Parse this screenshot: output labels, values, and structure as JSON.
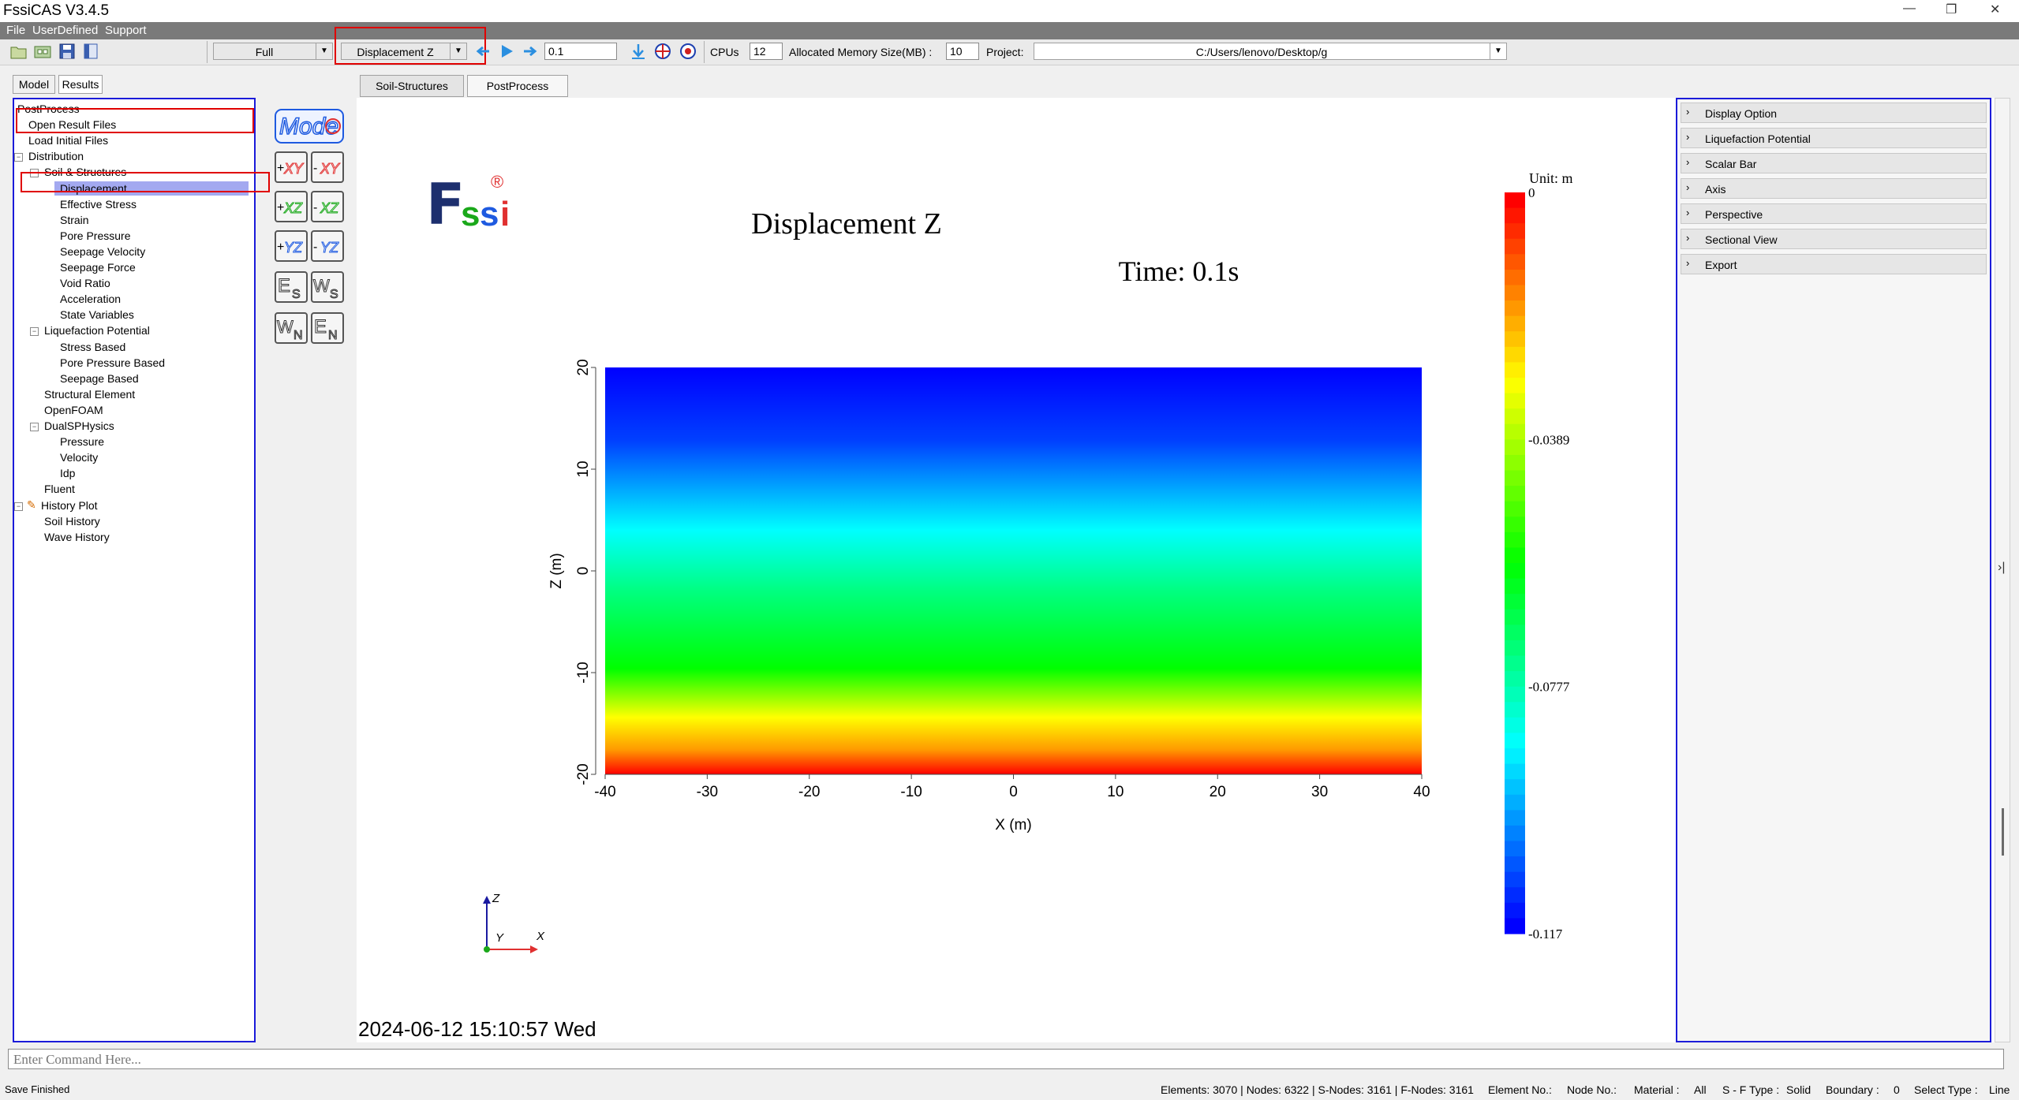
{
  "app": {
    "title": "FssiCAS V3.4.5"
  },
  "menu": [
    "File",
    "UserDefined",
    "Support"
  ],
  "toolbar": {
    "mode_select": "Full",
    "result_select": "Displacement Z",
    "step_value": "0.1",
    "cpus_label": "CPUs",
    "cpus_value": "12",
    "memory_label": "Allocated Memory Size(MB) :",
    "memory_value": "10",
    "project_label": "Project:",
    "project_value": "C:/Users/lenovo/Desktop/g"
  },
  "left_tabs": [
    "Model",
    "Results"
  ],
  "tree": [
    {
      "label": "PostProcess",
      "level": 0,
      "toggle": "",
      "icon": false
    },
    {
      "label": "Open Result Files",
      "level": 1,
      "toggle": "",
      "icon": false
    },
    {
      "label": "Load Initial Files",
      "level": 1,
      "toggle": "",
      "icon": false
    },
    {
      "label": "Distribution",
      "level": 1,
      "toggle": "-",
      "icon": false
    },
    {
      "label": "Soil & Structures",
      "level": 2,
      "toggle": "-",
      "icon": false
    },
    {
      "label": "Displacement",
      "level": 3,
      "toggle": "",
      "icon": false,
      "selected": true
    },
    {
      "label": "Effective Stress",
      "level": 3,
      "toggle": "",
      "icon": false
    },
    {
      "label": "Strain",
      "level": 3,
      "toggle": "",
      "icon": false
    },
    {
      "label": "Pore Pressure",
      "level": 3,
      "toggle": "",
      "icon": false
    },
    {
      "label": "Seepage Velocity",
      "level": 3,
      "toggle": "",
      "icon": false
    },
    {
      "label": "Seepage Force",
      "level": 3,
      "toggle": "",
      "icon": false
    },
    {
      "label": "Void Ratio",
      "level": 3,
      "toggle": "",
      "icon": false
    },
    {
      "label": "Acceleration",
      "level": 3,
      "toggle": "",
      "icon": false
    },
    {
      "label": "State Variables",
      "level": 3,
      "toggle": "",
      "icon": false
    },
    {
      "label": "Liquefaction Potential",
      "level": 2,
      "toggle": "-",
      "icon": false
    },
    {
      "label": "Stress Based",
      "level": 3,
      "toggle": "",
      "icon": false
    },
    {
      "label": "Pore Pressure Based",
      "level": 3,
      "toggle": "",
      "icon": false
    },
    {
      "label": "Seepage Based",
      "level": 3,
      "toggle": "",
      "icon": false
    },
    {
      "label": "Structural Element",
      "level": 2,
      "toggle": "",
      "icon": false
    },
    {
      "label": "OpenFOAM",
      "level": 2,
      "toggle": "",
      "icon": false
    },
    {
      "label": "DualSPHysics",
      "level": 2,
      "toggle": "-",
      "icon": false
    },
    {
      "label": "Pressure",
      "level": 3,
      "toggle": "",
      "icon": false
    },
    {
      "label": "Velocity",
      "level": 3,
      "toggle": "",
      "icon": false
    },
    {
      "label": "Idp",
      "level": 3,
      "toggle": "",
      "icon": false
    },
    {
      "label": "Fluent",
      "level": 2,
      "toggle": "",
      "icon": false
    },
    {
      "label": "History Plot",
      "level": 1,
      "toggle": "-",
      "icon": true
    },
    {
      "label": "Soil History",
      "level": 2,
      "toggle": "",
      "icon": false
    },
    {
      "label": "Wave History",
      "level": 2,
      "toggle": "",
      "icon": false
    }
  ],
  "view_buttons": {
    "model_label": "Mode",
    "xy_pos": "+",
    "xy_neg": "-",
    "xy": "XY",
    "xz_pos": "+",
    "xz_neg": "-",
    "xz": "XZ",
    "yz_pos": "+",
    "yz_neg": "-",
    "yz": "YZ",
    "es": [
      "E",
      "S"
    ],
    "ws": [
      "W",
      "S"
    ],
    "wn": [
      "W",
      "N"
    ],
    "en": [
      "E",
      "N"
    ]
  },
  "doc_tabs": [
    "Soil-Structures",
    "PostProcess"
  ],
  "viewport": {
    "logo": "Fssi",
    "logo_mark": "®",
    "title": "Displacement Z",
    "time": "Time: 0.1s",
    "timestamp": "2024-06-12 15:10:57 Wed",
    "triad": {
      "z": "Z",
      "y": "Y",
      "x": "X"
    }
  },
  "chart_data": {
    "type": "heatmap",
    "title": "Displacement Z",
    "xlabel": "X (m)",
    "ylabel": "Z (m)",
    "xlim": [
      -40,
      40
    ],
    "ylim": [
      -20,
      20
    ],
    "xticks": [
      -40,
      -30,
      -20,
      -10,
      0,
      10,
      20,
      30,
      40
    ],
    "yticks": [
      -20,
      -10,
      0,
      10,
      20
    ],
    "field": "value varies with Z only",
    "scalar_bar": {
      "unit_label": "Unit:  m",
      "min": -0.117,
      "max": 0,
      "labels": [
        "0",
        "-0.0389",
        "-0.0777",
        "-0.117"
      ],
      "colors_max_to_min": [
        "#ff0000",
        "#ffff00",
        "#00ff00",
        "#00ffff",
        "#0000ff"
      ]
    }
  },
  "right_panel": [
    "Display Option",
    "Liquefaction Potential",
    "Scalar Bar",
    "Axis",
    "Perspective",
    "Sectional View",
    "Export"
  ],
  "command": {
    "placeholder": "Enter Command Here..."
  },
  "status": {
    "left": "Save Finished",
    "elements": "Elements: 3070 | Nodes: 6322 | S-Nodes: 3161 | F-Nodes: 3161",
    "element_no": "Element No.:",
    "node_no": "Node No.:",
    "material_label": "Material :",
    "material_value": "All",
    "sf_label": "S - F Type :",
    "sf_value": "Solid",
    "boundary_label": "Boundary :",
    "boundary_value": "0",
    "select_label": "Select Type :",
    "select_value": "Line"
  }
}
